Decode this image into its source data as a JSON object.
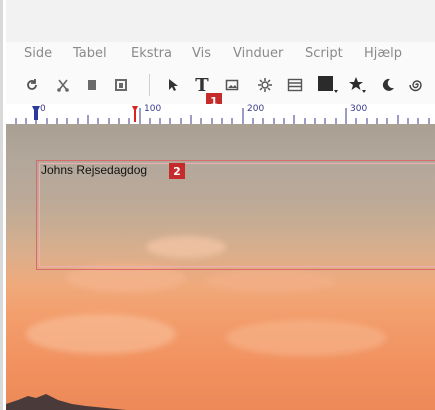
{
  "menu": {
    "items": [
      "Side",
      "Tabel",
      "Ekstra",
      "Vis",
      "Vinduer",
      "Script",
      "Hjælp"
    ]
  },
  "toolbar": {
    "icons": [
      "refresh-icon",
      "cut-icon",
      "copy-icon",
      "paste-icon",
      "select-arrow-icon",
      "text-tool-icon",
      "image-tool-icon",
      "gear-icon",
      "table-icon",
      "shape-fill-icon",
      "star-icon",
      "moon-icon",
      "spiral-icon"
    ],
    "text_tool_glyph": "T",
    "callout_1": "1"
  },
  "ruler": {
    "labels": [
      "0",
      "100",
      "200",
      "300"
    ]
  },
  "canvas": {
    "text_frame": {
      "content": "Johns Rejsedagdog",
      "callout_2": "2"
    }
  },
  "colors": {
    "callout_red": "#c62b2b",
    "frame_border": "#d96a6a",
    "ruler_text": "#3a3a8c"
  }
}
